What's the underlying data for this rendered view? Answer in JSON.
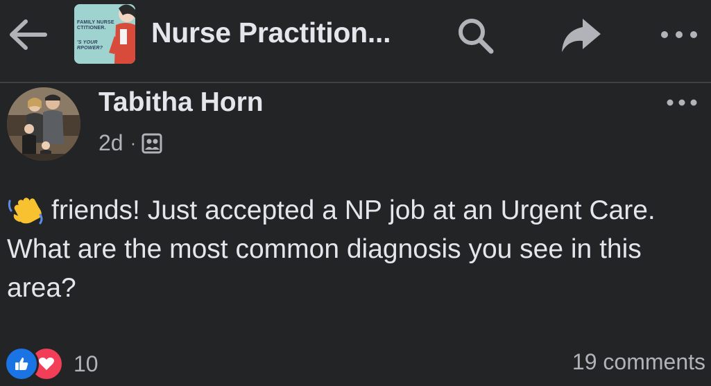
{
  "header": {
    "group_title": "Nurse Practition...",
    "thumb_lines": [
      "FAMILY NURSE",
      "CTITIONER.",
      "'S YOUR",
      "RPOWER?"
    ],
    "icons": {
      "back": "back-arrow-icon",
      "search": "search-icon",
      "share": "share-icon",
      "more": "more-options-icon"
    }
  },
  "post": {
    "author": "Tabitha Horn",
    "time": "2d",
    "separator": "·",
    "audience_icon": "group-audience-icon",
    "emoji": "waving-hand-emoji",
    "body": "friends! Just accepted a NP job at an Urgent Care. What are the most common diagnosis you see in this area?",
    "reactions": {
      "types": [
        "like",
        "love"
      ],
      "count": "10"
    },
    "comments_label": "19 comments"
  },
  "colors": {
    "background": "#232426",
    "text_primary": "#e4e6eb",
    "text_secondary": "#b0b3b8",
    "like_blue": "#1b74e4",
    "love_red": "#f33e58"
  }
}
